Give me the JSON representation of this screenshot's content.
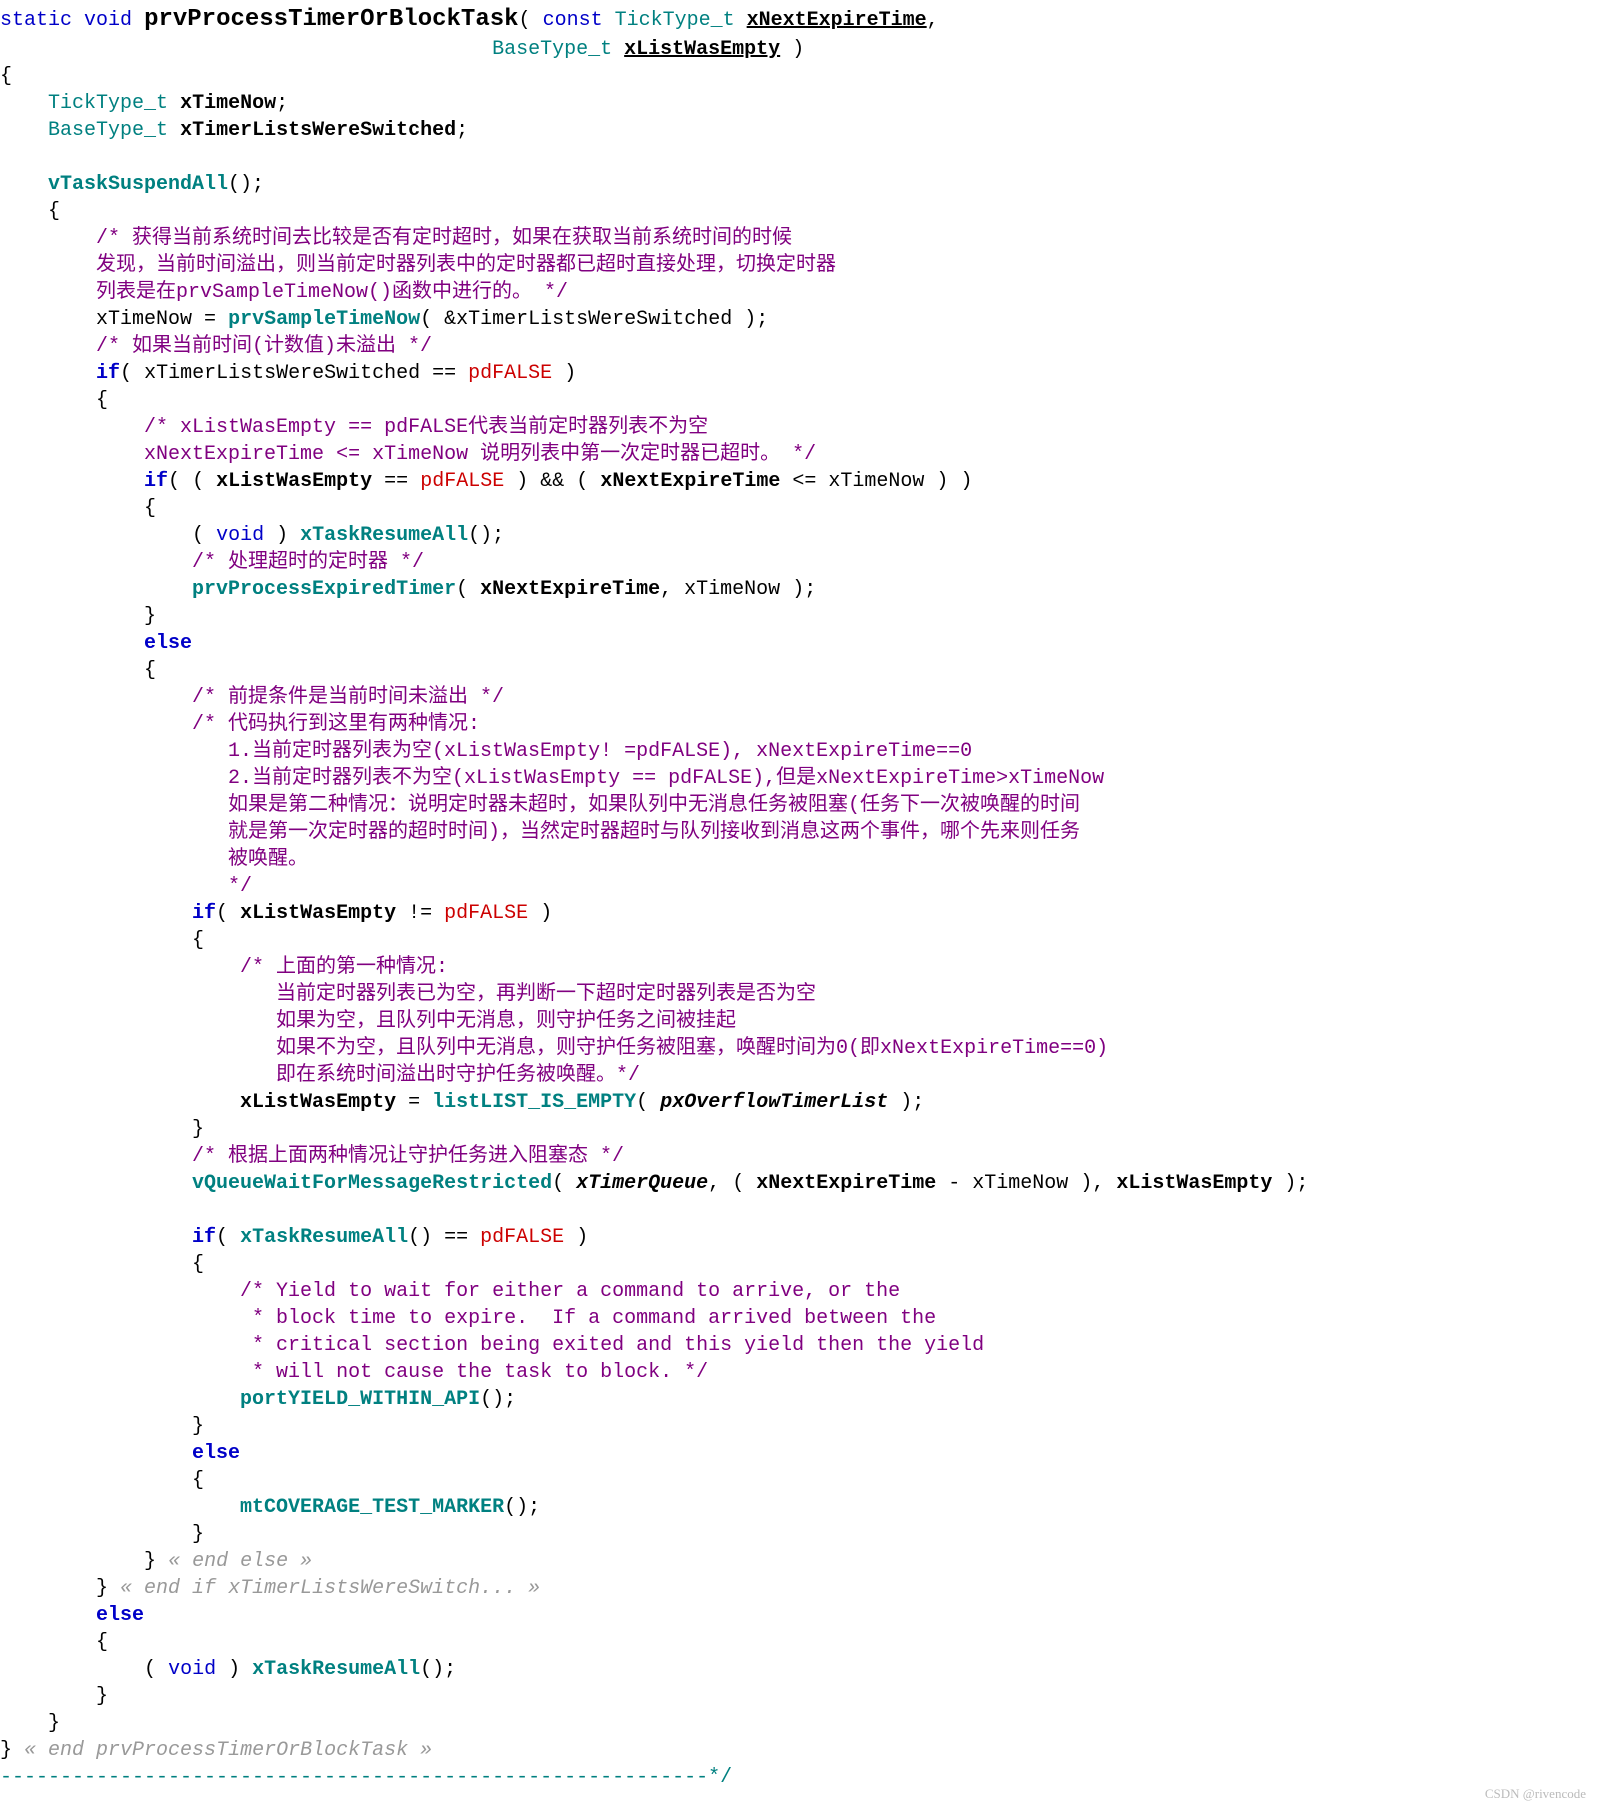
{
  "sig": {
    "static": "static",
    "void": "void",
    "name": "prvProcessTimerOrBlockTask",
    "lp": "(",
    "const": "const",
    "t1": "TickType_t",
    "p1": "xNextExpireTime",
    "comma": ",",
    "t2": "BaseType_t",
    "p2": "xListWasEmpty",
    "rp": ")"
  },
  "decl": {
    "t1": "TickType_t",
    "v1": "xTimeNow",
    "t2": "BaseType_t",
    "v2": "xTimerListsWereSwitched"
  },
  "call": {
    "suspend": "vTaskSuspendAll",
    "sample": "prvSampleTimeNow",
    "resumeAll": "xTaskResumeAll",
    "procExp": "prvProcessExpiredTimer",
    "listEmpty": "listLIST_IS_EMPTY",
    "qwait": "vQueueWaitForMessageRestricted",
    "yield": "portYIELD_WITHIN_API",
    "cov": "mtCOVERAGE_TEST_MARKER"
  },
  "kw": {
    "if": "if",
    "else": "else",
    "voidcast": "void"
  },
  "const": {
    "pdFALSE": "pdFALSE"
  },
  "var": {
    "xTimeNow": "xTimeNow",
    "xTimerListsWereSwitched": "xTimerListsWereSwitched",
    "xListWasEmpty": "xListWasEmpty",
    "xNextExpireTime": "xNextExpireTime",
    "xTimerQueue": "xTimerQueue",
    "pxOverflowTimerList": "pxOverflowTimerList"
  },
  "cm": {
    "c1a": "/* 获得当前系统时间去比较是否有定时超时，如果在获取当前系统时间的时候",
    "c1b": "发现，当前时间溢出，则当前定时器列表中的定时器都已超时直接处理，切换定时器",
    "c1c": "列表是在prvSampleTimeNow()函数中进行的。 */",
    "c2": "/* 如果当前时间(计数值)未溢出 */",
    "c3a": "/* xListWasEmpty == pdFALSE代表当前定时器列表不为空",
    "c3b": "xNextExpireTime <= xTimeNow 说明列表中第一次定时器已超时。 */",
    "c4": "/* 处理超时的定时器 */",
    "c5": "/* 前提条件是当前时间未溢出 */",
    "c6a": "/* 代码执行到这里有两种情况:",
    "c6b": "   1.当前定时器列表为空(xListWasEmpty! =pdFALSE), xNextExpireTime==0",
    "c6c": "   2.当前定时器列表不为空(xListWasEmpty == pdFALSE),但是xNextExpireTime>xTimeNow",
    "c6d": "   如果是第二种情况：说明定时器未超时，如果队列中无消息任务被阻塞(任务下一次被唤醒的时间",
    "c6e": "   就是第一次定时器的超时时间)，当然定时器超时与队列接收到消息这两个事件，哪个先来则任务",
    "c6f": "   被唤醒。",
    "c6g": "   */",
    "c7a": "/* 上面的第一种情况:",
    "c7b": "   当前定时器列表已为空，再判断一下超时定时器列表是否为空",
    "c7c": "   如果为空，且队列中无消息，则守护任务之间被挂起",
    "c7d": "   如果不为空，且队列中无消息，则守护任务被阻塞，唤醒时间为0(即xNextExpireTime==0)",
    "c7e": "   即在系统时间溢出时守护任务被唤醒。*/",
    "c8": "/* 根据上面两种情况让守护任务进入阻塞态 */",
    "c9a": "/* Yield to wait for either a command to arrive, or the",
    "c9b": " * block time to expire.  If a command arrived between the",
    "c9c": " * critical section being exited and this yield then the yield",
    "c9d": " * will not cause the task to block. */"
  },
  "fold": {
    "endelse": "« end else »",
    "endif": "« end if xTimerListsWereSwitch... »",
    "endfn": "« end prvProcessTimerOrBlockTask »"
  },
  "dash": "-----------------------------------------------------------*/",
  "watermark": "CSDN @rivencode"
}
